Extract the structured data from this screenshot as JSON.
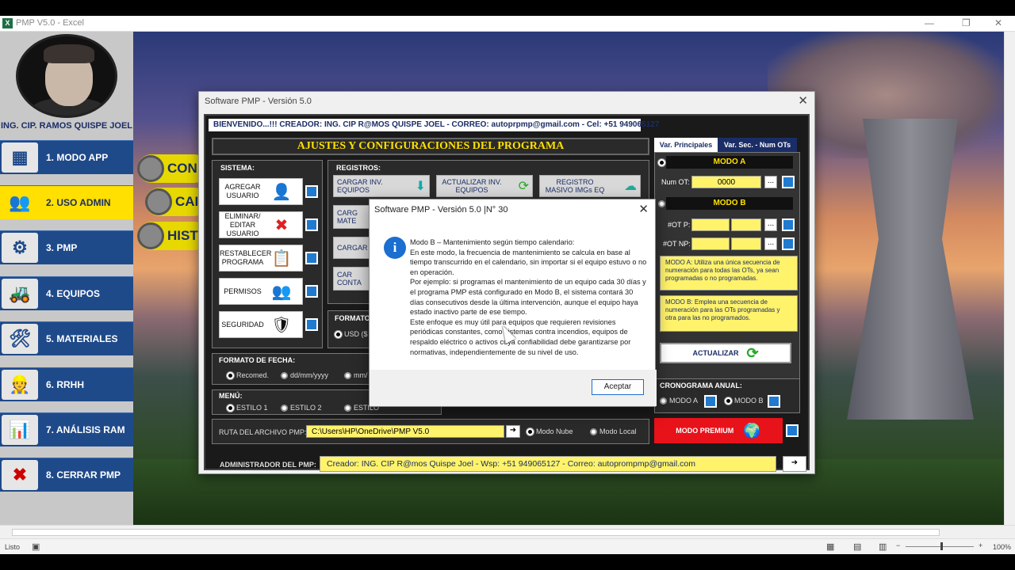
{
  "app": {
    "title": "PMP V5.0 - Excel"
  },
  "sidebar": {
    "owner": "ING. CIP. RAMOS QUISPE JOEL",
    "items": [
      {
        "label": "1. MODO APP",
        "icon": "dashboard-icon",
        "glyph": "▦"
      },
      {
        "label": "2. USO ADMIN",
        "icon": "users-icon",
        "glyph": "👥"
      },
      {
        "label": "3. PMP",
        "icon": "gears-icon",
        "glyph": "⚙"
      },
      {
        "label": "4. EQUIPOS",
        "icon": "excavator-icon",
        "glyph": "🚜"
      },
      {
        "label": "5. MATERIALES",
        "icon": "worker-tools-icon",
        "glyph": "🛠"
      },
      {
        "label": "6. RRHH",
        "icon": "team-icon",
        "glyph": "👷"
      },
      {
        "label": "7. ANÁLISIS RAM",
        "icon": "chart-icon",
        "glyph": "📊"
      },
      {
        "label": "8. CERRAR PMP",
        "icon": "close-circle-icon",
        "glyph": "✖"
      }
    ]
  },
  "background_buttons": [
    "CON",
    "CAI",
    "HIST"
  ],
  "window": {
    "title": "Software PMP - Versión 5.0",
    "welcome": "BIENVENIDO...!!!        CREADOR: ING. CIP R@MOS QUISPE JOEL - CORREO: autoprpmp@gmail.com - Cel: +51 949065127",
    "header": "AJUSTES Y CONFIGURACIONES DEL PROGRAMA",
    "sistema": {
      "label": "SISTEMA:",
      "buttons": [
        {
          "label": "AGREGAR USUARIO",
          "glyph": "👤"
        },
        {
          "label": "ELIMINAR/ EDITAR USUARIO",
          "glyph": "✖"
        },
        {
          "label": "RESTABLECER PROGRAMA",
          "glyph": "📋"
        },
        {
          "label": "PERMISOS",
          "glyph": "👥"
        },
        {
          "label": "SEGURIDAD",
          "glyph": "🛡"
        }
      ]
    },
    "registros": {
      "label": "REGISTROS:",
      "buttons": [
        {
          "label": "CARGAR INV. EQUIPOS",
          "glyph": "⬇"
        },
        {
          "label": "ACTUALIZAR INV. EQUIPOS",
          "glyph": "⟳"
        },
        {
          "label": "REGISTRO MASIVO IMGs EQ",
          "glyph": "☁"
        },
        {
          "label": "CARG MATE",
          "glyph": ""
        },
        {
          "label": "CARGAR",
          "glyph": ""
        },
        {
          "label": "CAR CONTA",
          "glyph": ""
        }
      ]
    },
    "formato": {
      "label": "FORMATO",
      "option": "USD ($"
    },
    "fecha": {
      "label": "FORMATO DE FECHA:",
      "options": [
        "Recomed.",
        "dd/mm/yyyy",
        "mm/"
      ]
    },
    "menu": {
      "label": "MENÚ:",
      "options": [
        "ESTILO 1",
        "ESTILO 2",
        "ESTILO"
      ]
    },
    "ruta": {
      "label": "RUTA DEL ARCHIVO PMP:",
      "value": "C:\\Users\\HP\\OneDrive\\PMP V5.0",
      "options": [
        "Modo Nube",
        "Modo Local"
      ]
    },
    "admin": {
      "label": "ADMINISTRADOR DEL PMP:",
      "value": "Creador: ING. CIP R@mos Quispe Joel - Wsp: +51 949065127 - Correo: autoprompmp@gmail.com"
    },
    "tabs": [
      "Var. Principales",
      "Var. Sec. - Num OTs"
    ],
    "modo_a": {
      "title": "MODO A",
      "num_ot_label": "Num OT:",
      "num_ot_value": "0000"
    },
    "modo_b": {
      "title": "MODO B",
      "ot_p_label": "#OT P:",
      "ot_np_label": "#OT NP:"
    },
    "note_a": "MODO A: Utiliza una única secuencia de numeración para todas las OTs, ya sean programadas o no programadas.",
    "note_b": "MODO B: Emplea una secuencia de numeración para las OTs programadas y otra para las no programados.",
    "actualizar": "ACTUALIZAR",
    "cronograma": {
      "label": "CRONOGRAMA ANUAL:",
      "options": [
        "MODO A",
        "MODO B"
      ]
    },
    "premium": "MODO PREMIUM",
    "ellipsis": "..."
  },
  "dialog": {
    "title": "Software PMP - Versión 5.0  |N° 30",
    "paragraphs": [
      "Modo B – Mantenimiento según tiempo calendario:",
      "En este modo, la frecuencia de mantenimiento se calcula en base al tiempo transcurrido en el calendario, sin importar si el equipo estuvo o no en operación.",
      "Por ejemplo: si programas el mantenimiento de un equipo cada 30 días y el programa PMP está configurado en Modo B, el sistema contará 30 días consecutivos desde la última intervención, aunque el equipo haya estado inactivo parte de ese tiempo.",
      "Este enfoque es muy útil para equipos que requieren revisiones periódicas constantes, como sistemas contra incendios, equipos de respaldo eléctrico o activos cuya confiabilidad debe garantizarse por normativas, independientemente de su nivel de uso."
    ],
    "ok": "Aceptar"
  },
  "status": {
    "ready": "Listo",
    "zoom": "100%"
  }
}
